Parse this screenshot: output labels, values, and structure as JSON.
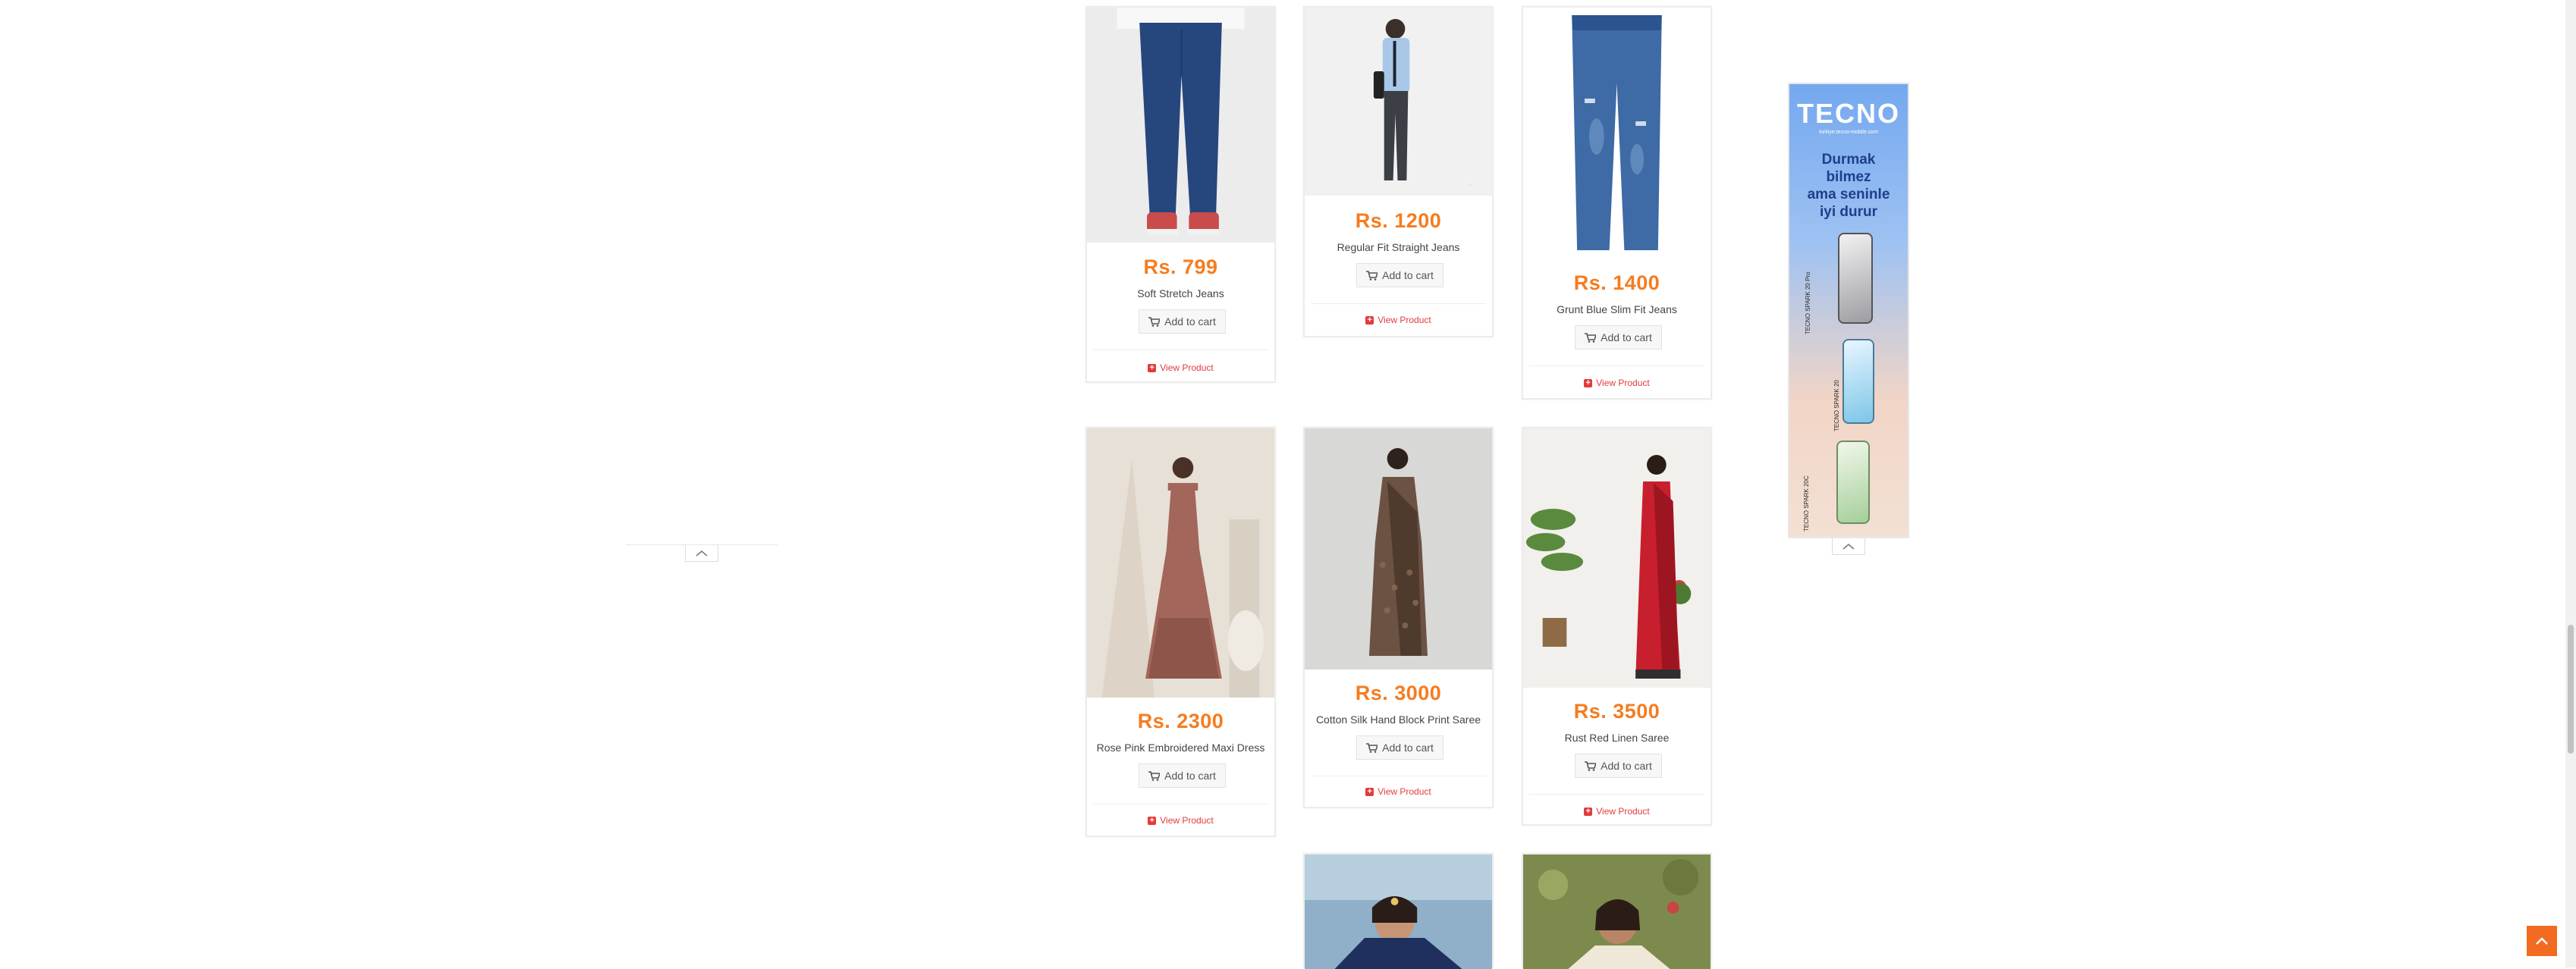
{
  "products": [
    {
      "price": "Rs. 799",
      "name": "Soft Stretch Jeans",
      "cart": "Add to cart",
      "view": "View Product"
    },
    {
      "price": "Rs. 1200",
      "name": "Regular Fit Straight Jeans",
      "cart": "Add to cart",
      "view": "View Product"
    },
    {
      "price": "Rs. 1400",
      "name": "Grunt Blue Slim Fit Jeans",
      "cart": "Add to cart",
      "view": "View Product"
    },
    {
      "price": "Rs. 2300",
      "name": "Rose Pink Embroidered Maxi Dress",
      "cart": "Add to cart",
      "view": "View Product"
    },
    {
      "price": "Rs. 3000",
      "name": "Cotton Silk Hand Block Print Saree",
      "cart": "Add to cart",
      "view": "View Product"
    },
    {
      "price": "Rs. 3500",
      "name": "Rust Red Linen Saree",
      "cart": "Add to cart",
      "view": "View Product"
    }
  ],
  "ad": {
    "brand": "TECNO",
    "url": "turkiye.tecno-mobile.com",
    "slogan_1": "Durmak",
    "slogan_2": "bilmez",
    "slogan_3": "ama seninle",
    "slogan_4": "iyi durur",
    "phone_1": "TECNO SPARK 20 Pro",
    "phone_2": "TECNO SPARK 20",
    "phone_3": "TECNO SPARK 20C"
  },
  "icons": {
    "cart": "cart-icon",
    "view": "plus-square-icon",
    "collapse": "chevron-up-icon",
    "scroll_top": "chevron-up-icon"
  },
  "colors": {
    "price": "#f57c1f",
    "view_link": "#e23b3b",
    "scroll_top": "#f26b21"
  }
}
